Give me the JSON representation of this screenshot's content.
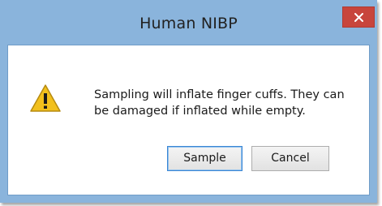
{
  "window": {
    "title": "Human NIBP",
    "close_icon": "close-icon"
  },
  "dialog": {
    "icon": "warning-icon",
    "message": "Sampling will inflate finger cuffs. They can be damaged if inflated while empty."
  },
  "buttons": {
    "sample_label": "Sample",
    "cancel_label": "Cancel"
  },
  "colors": {
    "frame": "#8ab4dc",
    "close_button": "#c8453c",
    "warning_fill": "#f2c01c"
  }
}
